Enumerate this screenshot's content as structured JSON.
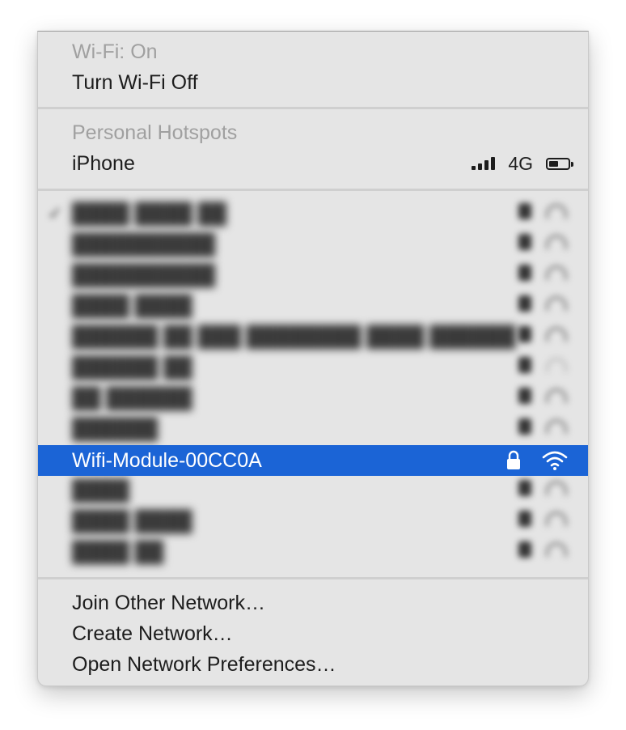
{
  "wifi_status": "Wi-Fi: On",
  "toggle_wifi": "Turn Wi-Fi Off",
  "hotspots": {
    "header": "Personal Hotspots",
    "device": "iPhone",
    "network_tech": "4G",
    "signal_bars": 4,
    "battery_level": 0.4
  },
  "networks_obscured": [
    {
      "blurred": true,
      "connected": true
    },
    {
      "blurred": true
    },
    {
      "blurred": true
    },
    {
      "blurred": true
    },
    {
      "blurred": true
    },
    {
      "blurred": true
    },
    {
      "blurred": true
    },
    {
      "blurred": true
    }
  ],
  "selected_network": {
    "name": "Wifi-Module-00CC0A",
    "secured": true,
    "lock_icon": "lock-icon",
    "wifi_icon": "wifi-icon"
  },
  "networks_obscured_after": [
    {
      "blurred": true
    },
    {
      "blurred": true
    },
    {
      "blurred": true
    }
  ],
  "footer": {
    "join_other": "Join Other Network…",
    "create": "Create Network…",
    "preferences": "Open Network Preferences…"
  },
  "colors": {
    "highlight": "#1b64d6",
    "menu_bg": "#e5e5e5",
    "text": "#1d1d1d",
    "disabled_text": "#a0a0a0"
  }
}
